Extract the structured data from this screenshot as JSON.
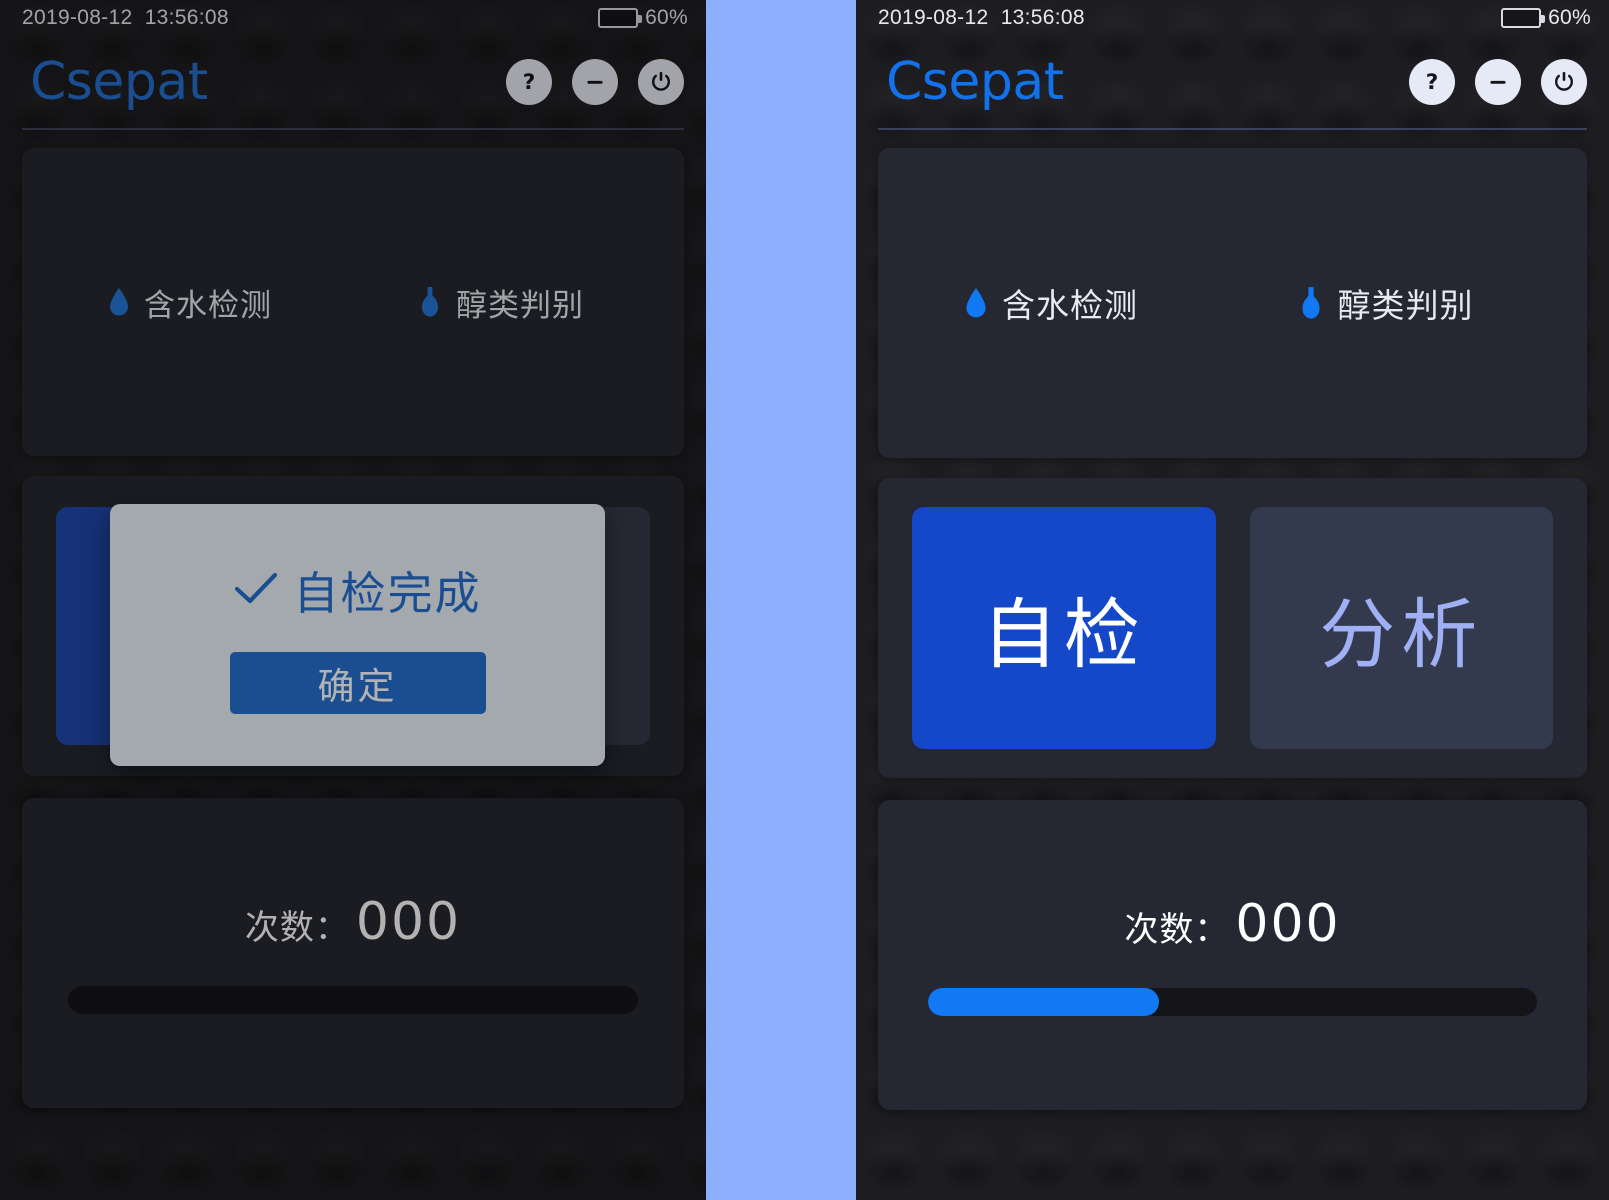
{
  "theme": {
    "accent_blue": "#1272ec",
    "primary_button_blue": "#1448c8",
    "ghost_button_bg": "#343a4e",
    "ghost_button_text": "#9fb0f5",
    "panel_bg": "#1d1d21",
    "card_bg": "#252833",
    "gap_blue": "#8CAEFC",
    "dialog_bg": "#e9f1fb"
  },
  "status_bar": {
    "datetime": "2019-08-12  13:56:08",
    "battery_percent": "60%",
    "battery_level": 60
  },
  "header": {
    "brand": "Csepat",
    "actions": [
      {
        "name": "help-button",
        "icon": "question-mark-icon",
        "label": "?"
      },
      {
        "name": "minimize-button",
        "icon": "minus-icon",
        "label": "−"
      },
      {
        "name": "power-button",
        "icon": "power-icon",
        "label": "⏻"
      }
    ]
  },
  "modes": [
    {
      "icon": "water-drop-icon",
      "label": "含水检测"
    },
    {
      "icon": "flask-bottle-icon",
      "label": "醇类判别"
    }
  ],
  "actions": [
    {
      "label": "自检",
      "state": "active"
    },
    {
      "label": "分析",
      "state": "inactive"
    }
  ],
  "counter": {
    "label": "次数：",
    "value": "000",
    "progress_percent_right": 38,
    "progress_percent_left": 0
  },
  "dialog": {
    "icon": "check-icon",
    "message": "自检完成",
    "confirm_label": "确定"
  }
}
